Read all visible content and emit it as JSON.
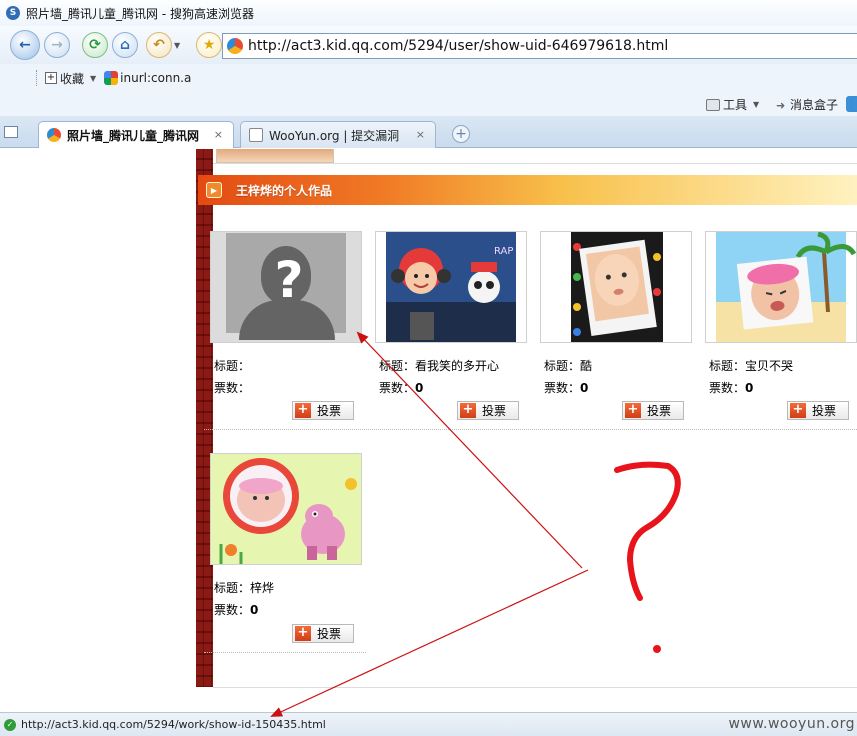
{
  "window": {
    "title": "照片墙_腾讯儿童_腾讯网 - 搜狗高速浏览器"
  },
  "toolbar": {
    "back_icon": "back-arrow",
    "forward_icon": "forward-arrow",
    "refresh_icon": "refresh",
    "home_icon": "home",
    "undo_icon": "undo",
    "favorite_icon": "star"
  },
  "address_bar": {
    "url": "http://act3.kid.qq.com/5294/user/show-uid-646979618.html"
  },
  "favorites_bar": {
    "items": [
      {
        "label": "收藏"
      },
      {
        "label": "inurl:conn.a"
      }
    ]
  },
  "command_bar": {
    "tools_label": "工具",
    "messages_label": "消息盒子"
  },
  "tabs": [
    {
      "label": "照片墙_腾讯儿童_腾讯网",
      "active": true,
      "close": "×"
    },
    {
      "label": "WooYun.org | 提交漏洞",
      "active": false,
      "close": "×"
    }
  ],
  "new_tab_glyph": "+",
  "page": {
    "section_title": "王梓烨的个人作品",
    "title_label": "标题：",
    "votes_label": "票数：",
    "vote_button_label": "投票",
    "vote_button_plus": "+",
    "placeholder_q": "?",
    "works": [
      {
        "title": "",
        "votes": ""
      },
      {
        "title": "看我笑的多开心",
        "votes": "0"
      },
      {
        "title": "酷",
        "votes": "0"
      },
      {
        "title": "宝贝不哭",
        "votes": "0"
      },
      {
        "title": "梓烨",
        "votes": "0"
      }
    ]
  },
  "status_bar": {
    "url": "http://act3.kid.qq.com/5294/work/show-id-150435.html",
    "watermark": "www.wooyun.org"
  },
  "colors": {
    "annotation_red": "#cc1111",
    "scribble_red": "#e8141b",
    "header_orange": "#e34a12",
    "brick_red": "#8b1a14"
  }
}
